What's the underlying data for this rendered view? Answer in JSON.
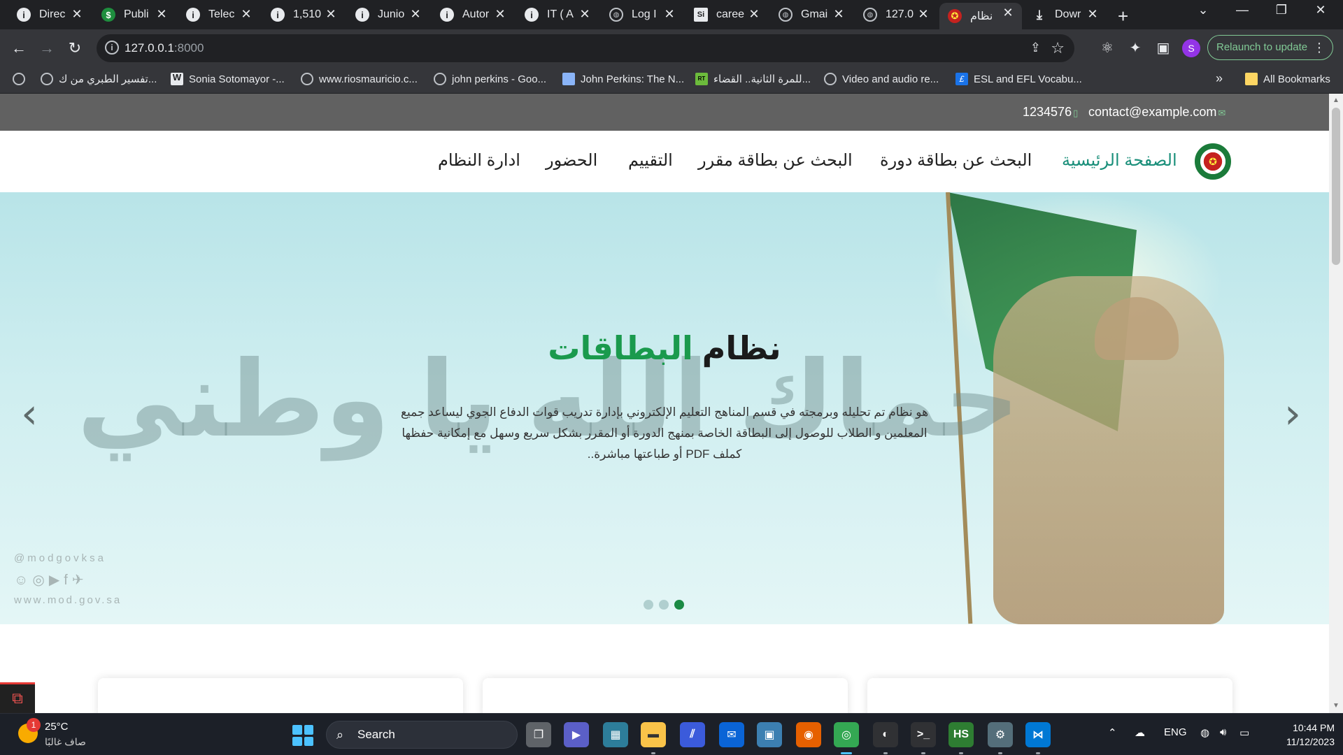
{
  "browser": {
    "tabs": [
      {
        "title": "Direc",
        "icon": "info-icon"
      },
      {
        "title": "Publi",
        "icon": "green-s-icon"
      },
      {
        "title": "Telec",
        "icon": "info-icon"
      },
      {
        "title": "1,510",
        "icon": "info-icon"
      },
      {
        "title": "Junio",
        "icon": "info-icon"
      },
      {
        "title": "Autor",
        "icon": "info-icon"
      },
      {
        "title": "IT ( A",
        "icon": "info-icon"
      },
      {
        "title": "Log I",
        "icon": "globe-icon"
      },
      {
        "title": "caree",
        "icon": "si-icon"
      },
      {
        "title": "Gmai",
        "icon": "globe-icon"
      },
      {
        "title": "127.0",
        "icon": "globe-icon"
      },
      {
        "title": "نظام",
        "icon": "seal-icon",
        "active": true
      },
      {
        "title": "Dowr",
        "icon": "download-icon"
      }
    ],
    "url_host": "127.0.0.1",
    "url_port": ":8000",
    "relaunch_label": "Relaunch to update",
    "profile_initial": "S",
    "bookmarks": [
      {
        "label": "",
        "icon": "globe-icon"
      },
      {
        "label": "تفسير الطبري من ك...",
        "icon": "globe-icon"
      },
      {
        "label": "Sonia Sotomayor -...",
        "icon": "wikipedia-icon"
      },
      {
        "label": "www.riosmauricio.c...",
        "icon": "globe-icon"
      },
      {
        "label": "john perkins - Goo...",
        "icon": "globe-icon"
      },
      {
        "label": "John Perkins: The N...",
        "icon": "image-icon"
      },
      {
        "label": "للمرة الثانية.. القضاء...",
        "icon": "rt-icon"
      },
      {
        "label": "Video and audio re...",
        "icon": "globe-icon"
      },
      {
        "label": "ESL and EFL Vocabu...",
        "icon": "esl-icon"
      }
    ],
    "all_bookmarks_label": "All Bookmarks"
  },
  "site": {
    "topbar": {
      "phone": "1234576",
      "email": "contact@example.com"
    },
    "nav": {
      "home": "الصفحة الرئيسية",
      "course_card": "البحث عن بطاقة دورة",
      "subject_card": "البحث عن بطاقة مقرر",
      "evaluation": "التقييم",
      "attendance": "الحضور",
      "admin": "ادارة النظام"
    },
    "hero": {
      "watermark": "حماك الله يا وطني",
      "title_main": "نظام",
      "title_accent": "البطاقات",
      "description": "هو نظام تم تحليله وبرمجته في قسم المناهج التعليم الإلكتروني بإدارة تدريب قوات الدفاع الجوي ليساعد جميع المعلمين و الطلاب للوصول إلى البطاقة الخاصة بمنهج الدورة أو المقرر بشكل سريع وسهل مع إمكانية حفظها كملف PDF أو طباعتها مباشرة..",
      "social_handle": "@modgovksa",
      "social_url": "www.mod.gov.sa",
      "slides": 3,
      "active_slide": 3
    },
    "accent_color": "#1a9a4d",
    "home_color": "#1a8f7a"
  },
  "taskbar": {
    "temperature": "25°C",
    "condition": "صاف غالبًا",
    "weather_badge": "1",
    "search_label": "Search",
    "language": "ENG",
    "time": "10:44 PM",
    "date": "11/12/2023"
  }
}
